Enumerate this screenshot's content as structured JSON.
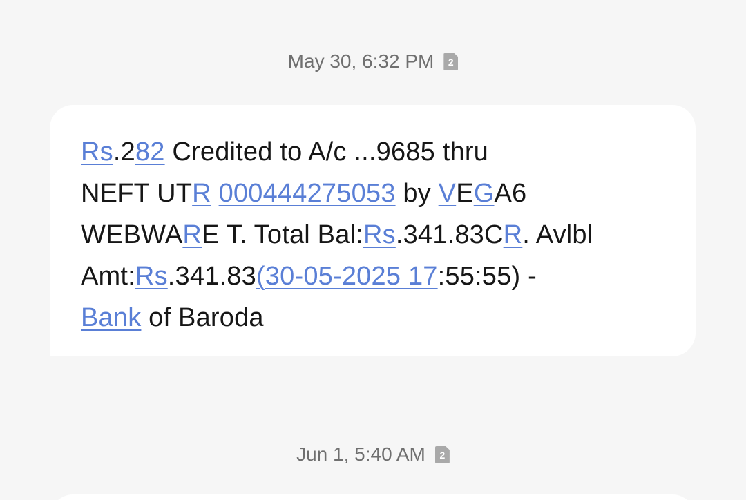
{
  "timestamps": [
    {
      "text": "May 30, 6:32 PM",
      "sim": "2"
    },
    {
      "text": "Jun 1, 5:40 AM",
      "sim": "2"
    }
  ],
  "message": {
    "lines": [
      [
        {
          "t": "Rs",
          "link": true
        },
        {
          "t": ".2",
          "link": false
        },
        {
          "t": "82",
          "link": true
        },
        {
          "t": " Credited to A/c ...9685 thru",
          "link": false
        }
      ],
      [
        {
          "t": "NEFT UT",
          "link": false
        },
        {
          "t": "R",
          "link": true
        },
        {
          "t": " ",
          "link": false
        },
        {
          "t": "000444275053",
          "link": true
        },
        {
          "t": " by ",
          "link": false
        },
        {
          "t": "V",
          "link": true
        },
        {
          "t": "E",
          "link": false
        },
        {
          "t": "G",
          "link": true
        },
        {
          "t": "A6",
          "link": false
        }
      ],
      [
        {
          "t": "WEBWA",
          "link": false
        },
        {
          "t": "R",
          "link": true
        },
        {
          "t": "E T. Total Bal:",
          "link": false
        },
        {
          "t": "Rs",
          "link": true
        },
        {
          "t": ".341.83C",
          "link": false
        },
        {
          "t": "R",
          "link": true
        },
        {
          "t": ". Avlbl",
          "link": false
        }
      ],
      [
        {
          "t": "Amt:",
          "link": false
        },
        {
          "t": "Rs",
          "link": true
        },
        {
          "t": ".341.83",
          "link": false
        },
        {
          "t": "(30-05-2025 17",
          "link": true
        },
        {
          "t": ":55:55) -",
          "link": false
        }
      ],
      [
        {
          "t": "Bank",
          "link": true
        },
        {
          "t": " of Baroda",
          "link": false
        }
      ]
    ]
  }
}
